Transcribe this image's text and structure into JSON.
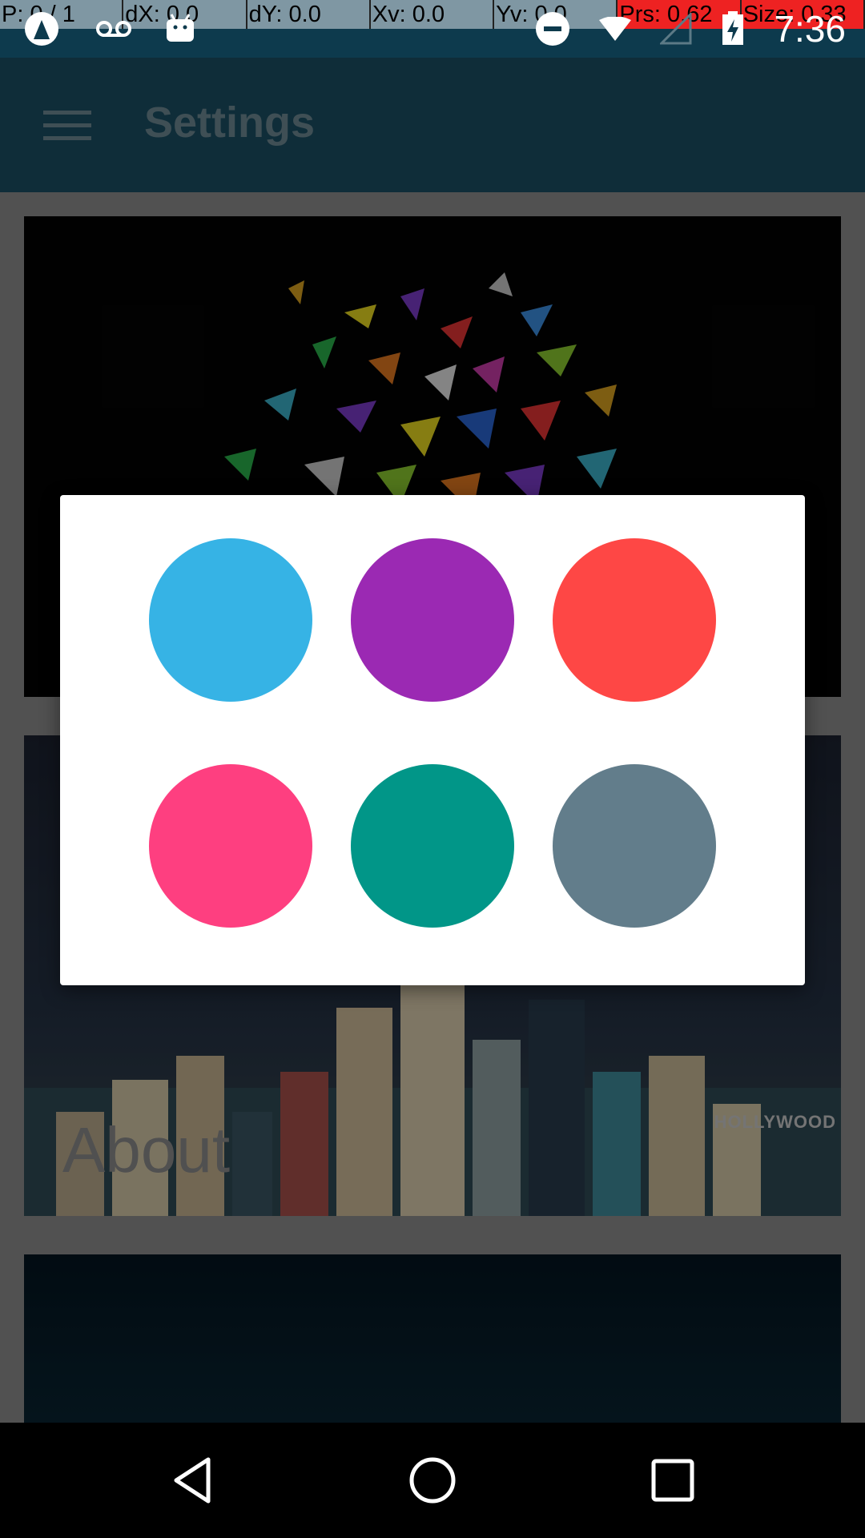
{
  "debug_overlay": {
    "pointer": "P: 0 / 1",
    "dx": "dX: 0.0",
    "dy": "dY: 0.0",
    "xv": "Xv: 0.0",
    "yv": "Yv: 0.0",
    "pressure": "Prs: 0.62",
    "size": "Size: 0.33"
  },
  "status_bar": {
    "time": "7:36",
    "icons": [
      "app-notification-icon",
      "voicemail-icon",
      "android-icon",
      "do-not-disturb-icon",
      "wifi-icon",
      "no-signal-icon",
      "battery-charging-icon"
    ]
  },
  "app_bar": {
    "title": "Settings",
    "menu_icon": "hamburger-menu-icon"
  },
  "cards": [
    {
      "name": "confetti",
      "label": ""
    },
    {
      "name": "city",
      "label": "About",
      "sign": "HOLLYWOOD"
    },
    {
      "name": "third",
      "label": ""
    }
  ],
  "color_dialog": {
    "swatches": [
      {
        "name": "light-blue",
        "color": "#36b3e5"
      },
      {
        "name": "purple",
        "color": "#9b29b3"
      },
      {
        "name": "red",
        "color": "#fe4745"
      },
      {
        "name": "pink",
        "color": "#fe3f80"
      },
      {
        "name": "teal",
        "color": "#019688"
      },
      {
        "name": "blue-grey",
        "color": "#627d8b"
      }
    ]
  },
  "nav_bar": {
    "buttons": [
      "back-icon",
      "home-icon",
      "recents-icon"
    ]
  }
}
